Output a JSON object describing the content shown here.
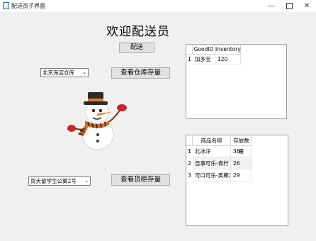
{
  "window": {
    "title": "配送员子界面"
  },
  "heading": "欢迎配送员",
  "deliver_button": "配送",
  "warehouse": {
    "select_value": "北京海淀仓库",
    "check_button": "查看仓库存量",
    "columns": [
      "GoodID",
      "Inventory"
    ],
    "rows": [
      {
        "index": "1",
        "cells": [
          "加多宝",
          "120"
        ]
      }
    ]
  },
  "cabinet": {
    "select_value": "贸大留学生公寓2号",
    "check_button": "查看货柜存量",
    "columns": [
      "商品名称",
      "存放数量"
    ],
    "rows": [
      {
        "index": "1",
        "cells": [
          "北冰洋",
          "36"
        ]
      },
      {
        "index": "2",
        "cells": [
          "百事可乐-青柠",
          "26"
        ]
      },
      {
        "index": "3",
        "cells": [
          "可口可乐-荚椰派",
          "29"
        ]
      }
    ]
  },
  "icons": {
    "app": "app-window-icon",
    "mascot": "snowman-icon"
  }
}
